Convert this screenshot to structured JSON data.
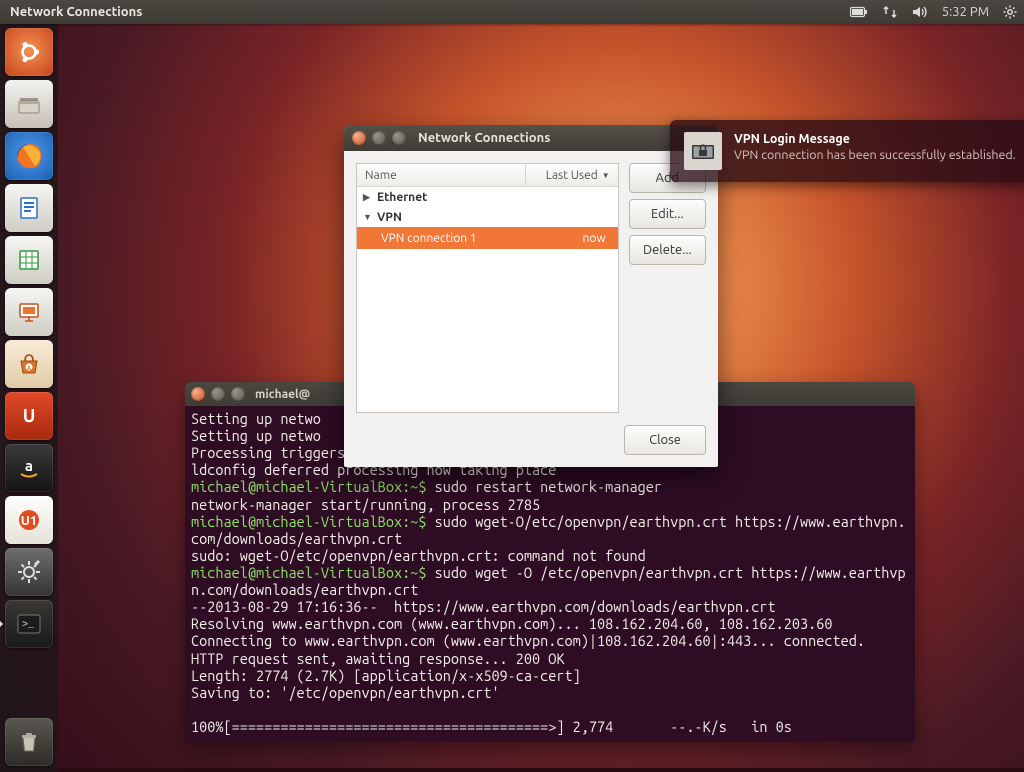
{
  "panel": {
    "app_title": "Network Connections",
    "time": "5:32 PM"
  },
  "launcher_apps": [
    {
      "name": "dash-home",
      "bg": "radial-gradient(circle at 50% 45%, #f59250, #c5431e)",
      "glyph": "◉"
    },
    {
      "name": "files-nautilus",
      "bg": "linear-gradient(#f3f2ef,#c6c0b6)"
    },
    {
      "name": "firefox",
      "bg": "radial-gradient(circle at 50% 45%, #ffca7a, #e24c14)"
    },
    {
      "name": "libreoffice-writer",
      "bg": "linear-gradient(#f6f6f4,#cfccc3)"
    },
    {
      "name": "libreoffice-calc",
      "bg": "linear-gradient(#f6f6f4,#cfccc3)"
    },
    {
      "name": "libreoffice-impress",
      "bg": "linear-gradient(#f6f6f4,#cfccc3)"
    },
    {
      "name": "software-center",
      "bg": "linear-gradient(#f0a24a,#c25b12)"
    },
    {
      "name": "ubuntu-one",
      "bg": "linear-gradient(#e14926,#a82a10)"
    },
    {
      "name": "amazon-store",
      "bg": "linear-gradient(#3a3a3a,#141414)"
    },
    {
      "name": "ubuntu-one-music",
      "bg": "radial-gradient(circle at 50% 45%,#f18a57,#c64016)"
    },
    {
      "name": "system-settings",
      "bg": "linear-gradient(#6d6d6d,#343434)"
    },
    {
      "name": "terminal",
      "bg": "linear-gradient(#3a3834,#1a1917)",
      "running": true
    }
  ],
  "terminal": {
    "title": "michael@",
    "lines": [
      "Setting up netwo",
      "Setting up netwo",
      "Processing triggers",
      "ldconfig deferred processing now taking place",
      {
        "prompt": "michael@michael-VirtualBox:~$",
        "cmd": " sudo restart network-manager"
      },
      "network-manager start/running, process 2785",
      {
        "prompt": "michael@michael-VirtualBox:~$",
        "cmd": " sudo wget-O/etc/openvpn/earthvpn.crt https://www.earthvpn.com/downloads/earthvpn.crt"
      },
      "sudo: wget-O/etc/openvpn/earthvpn.crt: command not found",
      {
        "prompt": "michael@michael-VirtualBox:~$",
        "cmd": " sudo wget -O /etc/openvpn/earthvpn.crt https://www.earthvpn.com/downloads/earthvpn.crt"
      },
      "--2013-08-29 17:16:36--  https://www.earthvpn.com/downloads/earthvpn.crt",
      "Resolving www.earthvpn.com (www.earthvpn.com)... 108.162.204.60, 108.162.203.60",
      "Connecting to www.earthvpn.com (www.earthvpn.com)|108.162.204.60|:443... connected.",
      "HTTP request sent, awaiting response... 200 OK",
      "Length: 2774 (2.7K) [application/x-x509-ca-cert]",
      "Saving to: '/etc/openvpn/earthvpn.crt'",
      "",
      "100%[=======================================>] 2,774       --.-K/s   in 0s"
    ]
  },
  "nc": {
    "title": "Network Connections",
    "col_name": "Name",
    "col_last": "Last Used",
    "groups": [
      {
        "label": "Ethernet",
        "expanded": false
      },
      {
        "label": "VPN",
        "expanded": true
      }
    ],
    "vpn_row": {
      "label": "VPN connection 1",
      "used": "now"
    },
    "btn_add": "Add",
    "btn_edit": "Edit...",
    "btn_delete": "Delete...",
    "btn_close": "Close"
  },
  "notification": {
    "title": "VPN Login Message",
    "body": "VPN connection has been successfully established."
  }
}
